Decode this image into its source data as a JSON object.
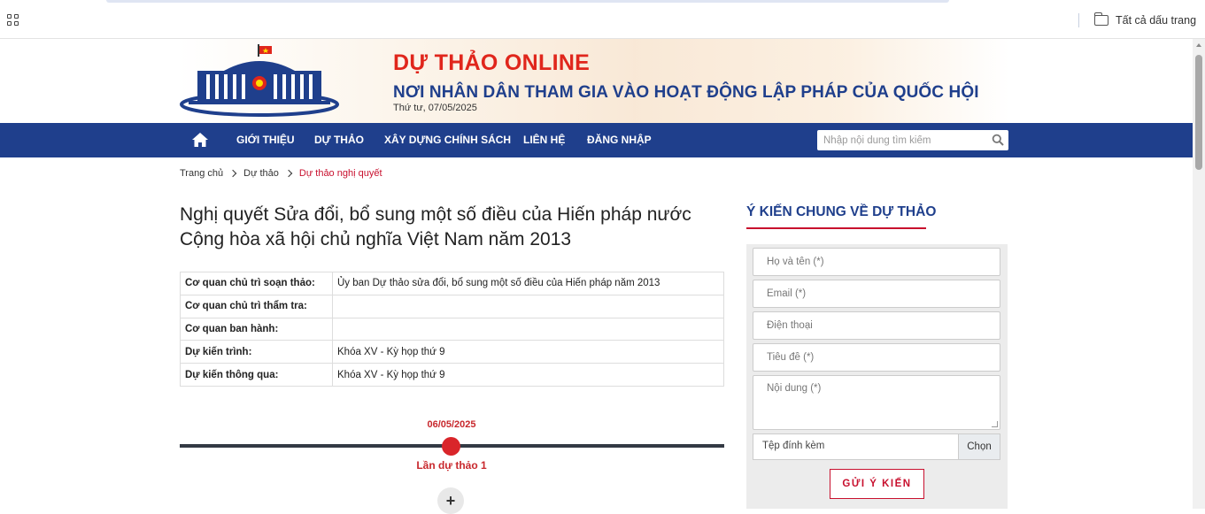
{
  "browser": {
    "all_bookmarks_label": "Tất cả dấu trang"
  },
  "site": {
    "title": "DỰ THẢO ONLINE",
    "slogan": "NƠI NHÂN DÂN THAM GIA VÀO HOẠT ĐỘNG LẬP PHÁP CỦA QUỐC HỘI",
    "date": "Thứ tư, 07/05/2025"
  },
  "nav": {
    "items": [
      "GIỚI THIỆU",
      "DỰ THẢO",
      "XÂY DỰNG CHÍNH SÁCH",
      "LIÊN HỆ",
      "ĐĂNG NHẬP"
    ],
    "search_placeholder": "Nhập nội dung tìm kiếm"
  },
  "breadcrumb": [
    "Trang chủ",
    "Dự thảo",
    "Dự thảo nghị quyết"
  ],
  "page": {
    "title": "Nghị quyết Sửa đổi, bổ sung một số điều của Hiến pháp nước Cộng hòa xã hội chủ nghĩa Việt Nam năm 2013"
  },
  "info_table": [
    {
      "label": "Cơ quan chủ trì soạn thảo:",
      "value": "Ủy ban Dự thảo sửa đổi, bổ sung một số điều của Hiến pháp năm 2013"
    },
    {
      "label": "Cơ quan chủ trì thẩm tra:",
      "value": ""
    },
    {
      "label": "Cơ quan ban hành:",
      "value": ""
    },
    {
      "label": "Dự kiến trình:",
      "value": "Khóa XV - Kỳ họp thứ 9"
    },
    {
      "label": "Dự kiến thông qua:",
      "value": "Khóa XV - Kỳ họp thứ 9"
    }
  ],
  "timeline": {
    "date": "06/05/2025",
    "label": "Lần dự thảo 1",
    "expand": "+"
  },
  "feedback": {
    "title": "Ý KIẾN CHUNG VỀ DỰ THẢO",
    "name_placeholder": "Họ và tên (*)",
    "email_placeholder": "Email (*)",
    "phone_placeholder": "Điện thoại",
    "subject_placeholder": "Tiêu đề (*)",
    "content_placeholder": "Nội dung (*)",
    "attachment_label": "Tệp đính kèm",
    "choose_label": "Chọn",
    "submit_label": "GỬI Ý KIẾN"
  },
  "colors": {
    "nav_bg": "#1f3f8c",
    "title_red": "#e0261c",
    "slogan_blue": "#1f3f8c",
    "accent_red": "#c8102e"
  }
}
